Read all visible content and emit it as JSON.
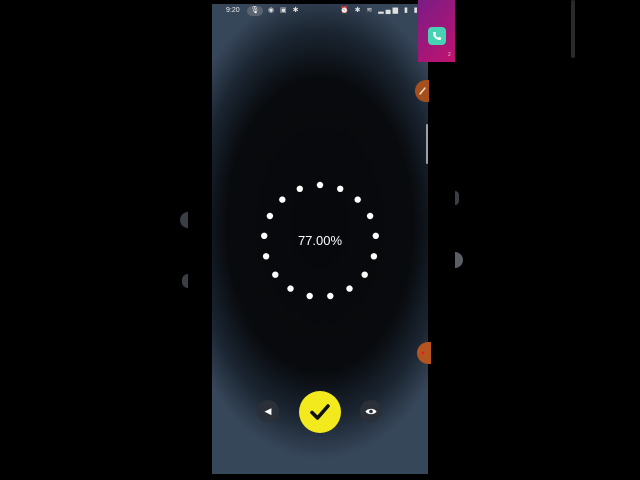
{
  "status_bar": {
    "time": "9:20",
    "mic_glyph": "🎙",
    "left_icons": "◉ ▣ ✱",
    "right_icons": "⏰ ✱ ≋ ▂▄▆ ▮ ▮"
  },
  "loader": {
    "progress_text": "77.00%",
    "progress": 0.77,
    "dot_count": 17,
    "dot_color": "#ffffff"
  },
  "controls": {
    "back_glyph": "◀",
    "back_icon": "back-arrow-icon",
    "confirm_icon": "checkmark-icon",
    "confirm_color": "#f3ea1d",
    "eye_icon": "eye-icon"
  },
  "side_panel": {
    "icon": "phone-call-icon",
    "badge": "2",
    "accent": "#c0136e"
  }
}
